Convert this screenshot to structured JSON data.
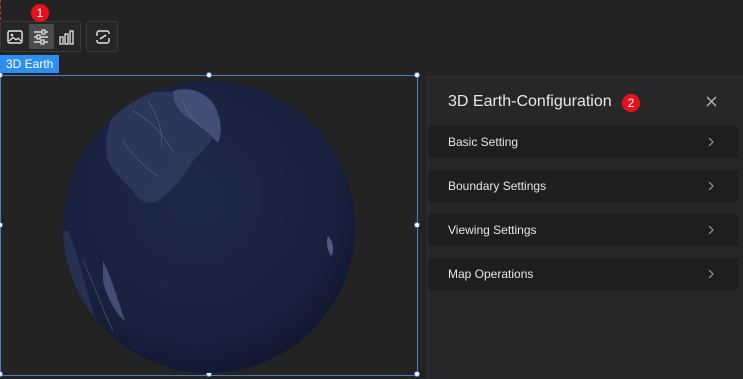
{
  "toolbar": {
    "tools": [
      {
        "icon": "image-icon"
      },
      {
        "icon": "sliders-icon",
        "active": true
      },
      {
        "icon": "bar-chart-icon"
      }
    ],
    "extra_tool": {
      "icon": "link-swap-icon"
    }
  },
  "badges": {
    "b1": "1",
    "b2": "2"
  },
  "component": {
    "tag": "3D Earth"
  },
  "panel": {
    "title": "3D Earth-Configuration",
    "sections": [
      {
        "label": "Basic Setting"
      },
      {
        "label": "Boundary Settings"
      },
      {
        "label": "Viewing Settings"
      },
      {
        "label": "Map Operations"
      }
    ]
  },
  "colors": {
    "accent": "#2e8ff0",
    "badge": "#e8101a",
    "globe_ocean": "#1b2442",
    "panel_bg": "#27272a",
    "section_bg": "#1e1e20"
  }
}
